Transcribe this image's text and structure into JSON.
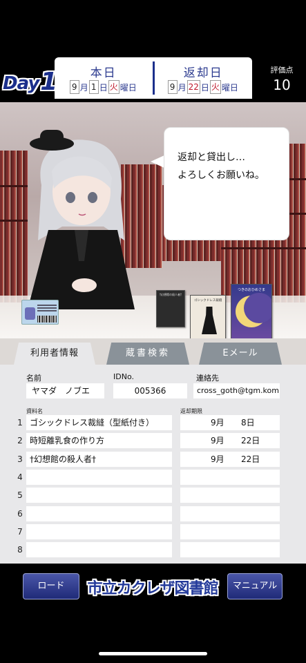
{
  "header": {
    "day_word": "Day",
    "day_number": "1",
    "today": {
      "title": "本日",
      "month": "9",
      "month_unit": "月",
      "day": "1",
      "day_unit": "日",
      "weekday": "火",
      "weekday_unit": "曜日"
    },
    "return": {
      "title": "返却日",
      "month": "9",
      "month_unit": "月",
      "day": "22",
      "day_unit": "日",
      "weekday": "火",
      "weekday_unit": "曜日"
    },
    "score_label": "評価点",
    "score_value": "10"
  },
  "scene": {
    "speech": [
      "返却と貸出し…",
      "よろしくお願いね。"
    ],
    "book_titles": [
      "†幻想館の殺人者†",
      "ゴシックドレス裁縫",
      "つきのおひめさま"
    ]
  },
  "tabs": [
    {
      "label": "利用者情報",
      "active": true
    },
    {
      "label": "蔵書検索",
      "active": false
    },
    {
      "label": "Eメール",
      "active": false
    }
  ],
  "form": {
    "name_label": "名前",
    "name_value": "ヤマダ　ノブエ",
    "id_label": "IDNo.",
    "id_value": "005366",
    "contact_label": "連絡先",
    "contact_value": "cross_goth@tgm.kom",
    "material_label": "資料名",
    "due_label": "返却期限",
    "rows": [
      {
        "num": "1",
        "title": "ゴシックドレス裁縫（型紙付き）",
        "month": "9月",
        "day": "8日"
      },
      {
        "num": "2",
        "title": "時短離乳食の作り方",
        "month": "9月",
        "day": "22日"
      },
      {
        "num": "3",
        "title": "†幻想館の殺人者†",
        "month": "9月",
        "day": "22日"
      },
      {
        "num": "4",
        "title": "",
        "month": "",
        "day": ""
      },
      {
        "num": "5",
        "title": "",
        "month": "",
        "day": ""
      },
      {
        "num": "6",
        "title": "",
        "month": "",
        "day": ""
      },
      {
        "num": "7",
        "title": "",
        "month": "",
        "day": ""
      },
      {
        "num": "8",
        "title": "",
        "month": "",
        "day": ""
      }
    ]
  },
  "footer": {
    "load_label": "ロード",
    "logo_text": "市立カクレザ図書館",
    "manual_label": "マニュアル"
  }
}
